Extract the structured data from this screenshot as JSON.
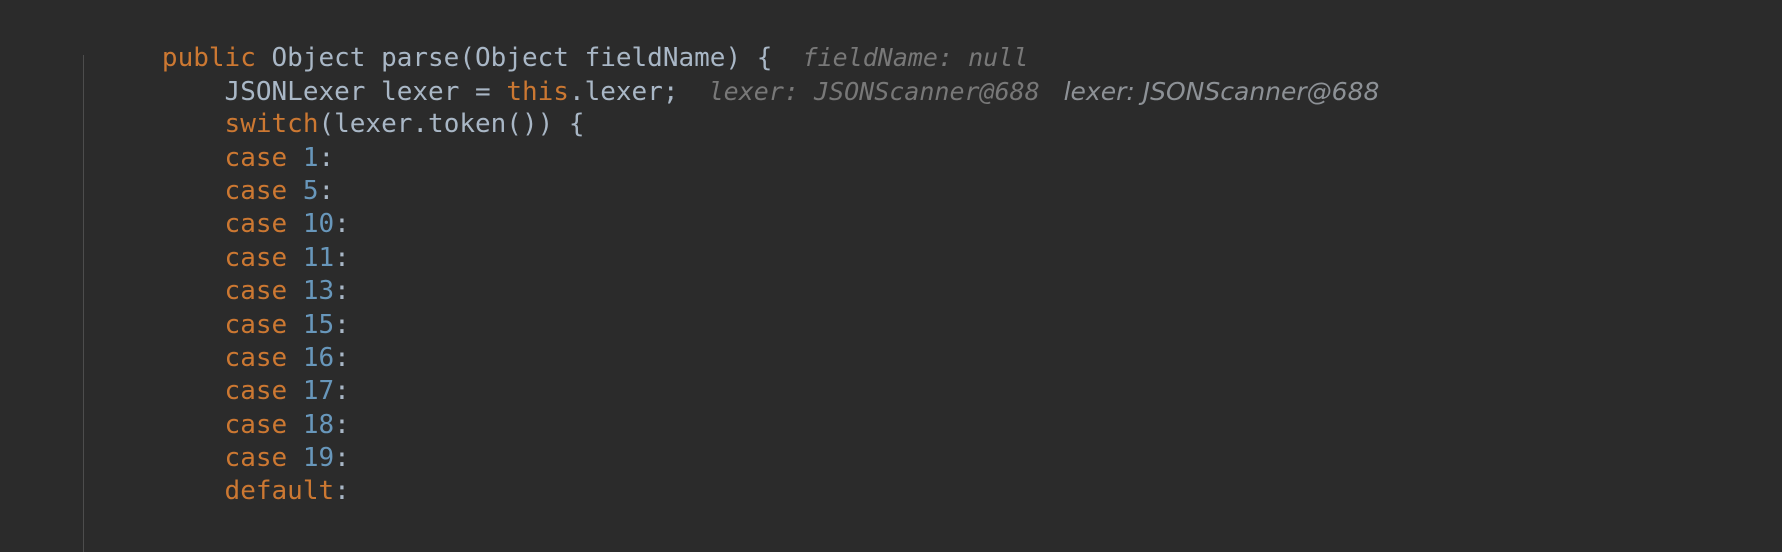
{
  "editor": {
    "theme_name": "darcula",
    "background_color": "#2b2b2b",
    "default_text_color": "#a9b7c6",
    "keyword_color": "#cc7832",
    "number_color": "#6897bb",
    "hint_color": "#787878",
    "indent_guide_color": "#4d4d4d"
  },
  "code": {
    "lines": [
      {
        "id": "line-signature",
        "indent": "",
        "keyword": "public",
        "after_keyword": " Object parse(Object fieldName) {",
        "hint": "fieldName: null"
      },
      {
        "id": "line-lexer-decl",
        "indent": "    ",
        "segment_a": "JSONLexer lexer = ",
        "keyword": "this",
        "after_keyword": ".lexer;",
        "hint": "lexer: JSONScanner@688",
        "hint2": "lexer: JSONScanner@688"
      },
      {
        "id": "line-switch",
        "indent": "    ",
        "keyword": "switch",
        "after_keyword": "(lexer.token()) {"
      },
      {
        "id": "line-case-1",
        "indent": "    ",
        "keyword": "case",
        "number": "1",
        "suffix": ":"
      },
      {
        "id": "line-case-5",
        "indent": "    ",
        "keyword": "case",
        "number": "5",
        "suffix": ":"
      },
      {
        "id": "line-case-10",
        "indent": "    ",
        "keyword": "case",
        "number": "10",
        "suffix": ":"
      },
      {
        "id": "line-case-11",
        "indent": "    ",
        "keyword": "case",
        "number": "11",
        "suffix": ":"
      },
      {
        "id": "line-case-13",
        "indent": "    ",
        "keyword": "case",
        "number": "13",
        "suffix": ":"
      },
      {
        "id": "line-case-15",
        "indent": "    ",
        "keyword": "case",
        "number": "15",
        "suffix": ":"
      },
      {
        "id": "line-case-16",
        "indent": "    ",
        "keyword": "case",
        "number": "16",
        "suffix": ":"
      },
      {
        "id": "line-case-17",
        "indent": "    ",
        "keyword": "case",
        "number": "17",
        "suffix": ":"
      },
      {
        "id": "line-case-18",
        "indent": "    ",
        "keyword": "case",
        "number": "18",
        "suffix": ":"
      },
      {
        "id": "line-case-19",
        "indent": "    ",
        "keyword": "case",
        "number": "19",
        "suffix": ":"
      },
      {
        "id": "line-default",
        "indent": "    ",
        "keyword": "default",
        "suffix": ":"
      }
    ]
  }
}
